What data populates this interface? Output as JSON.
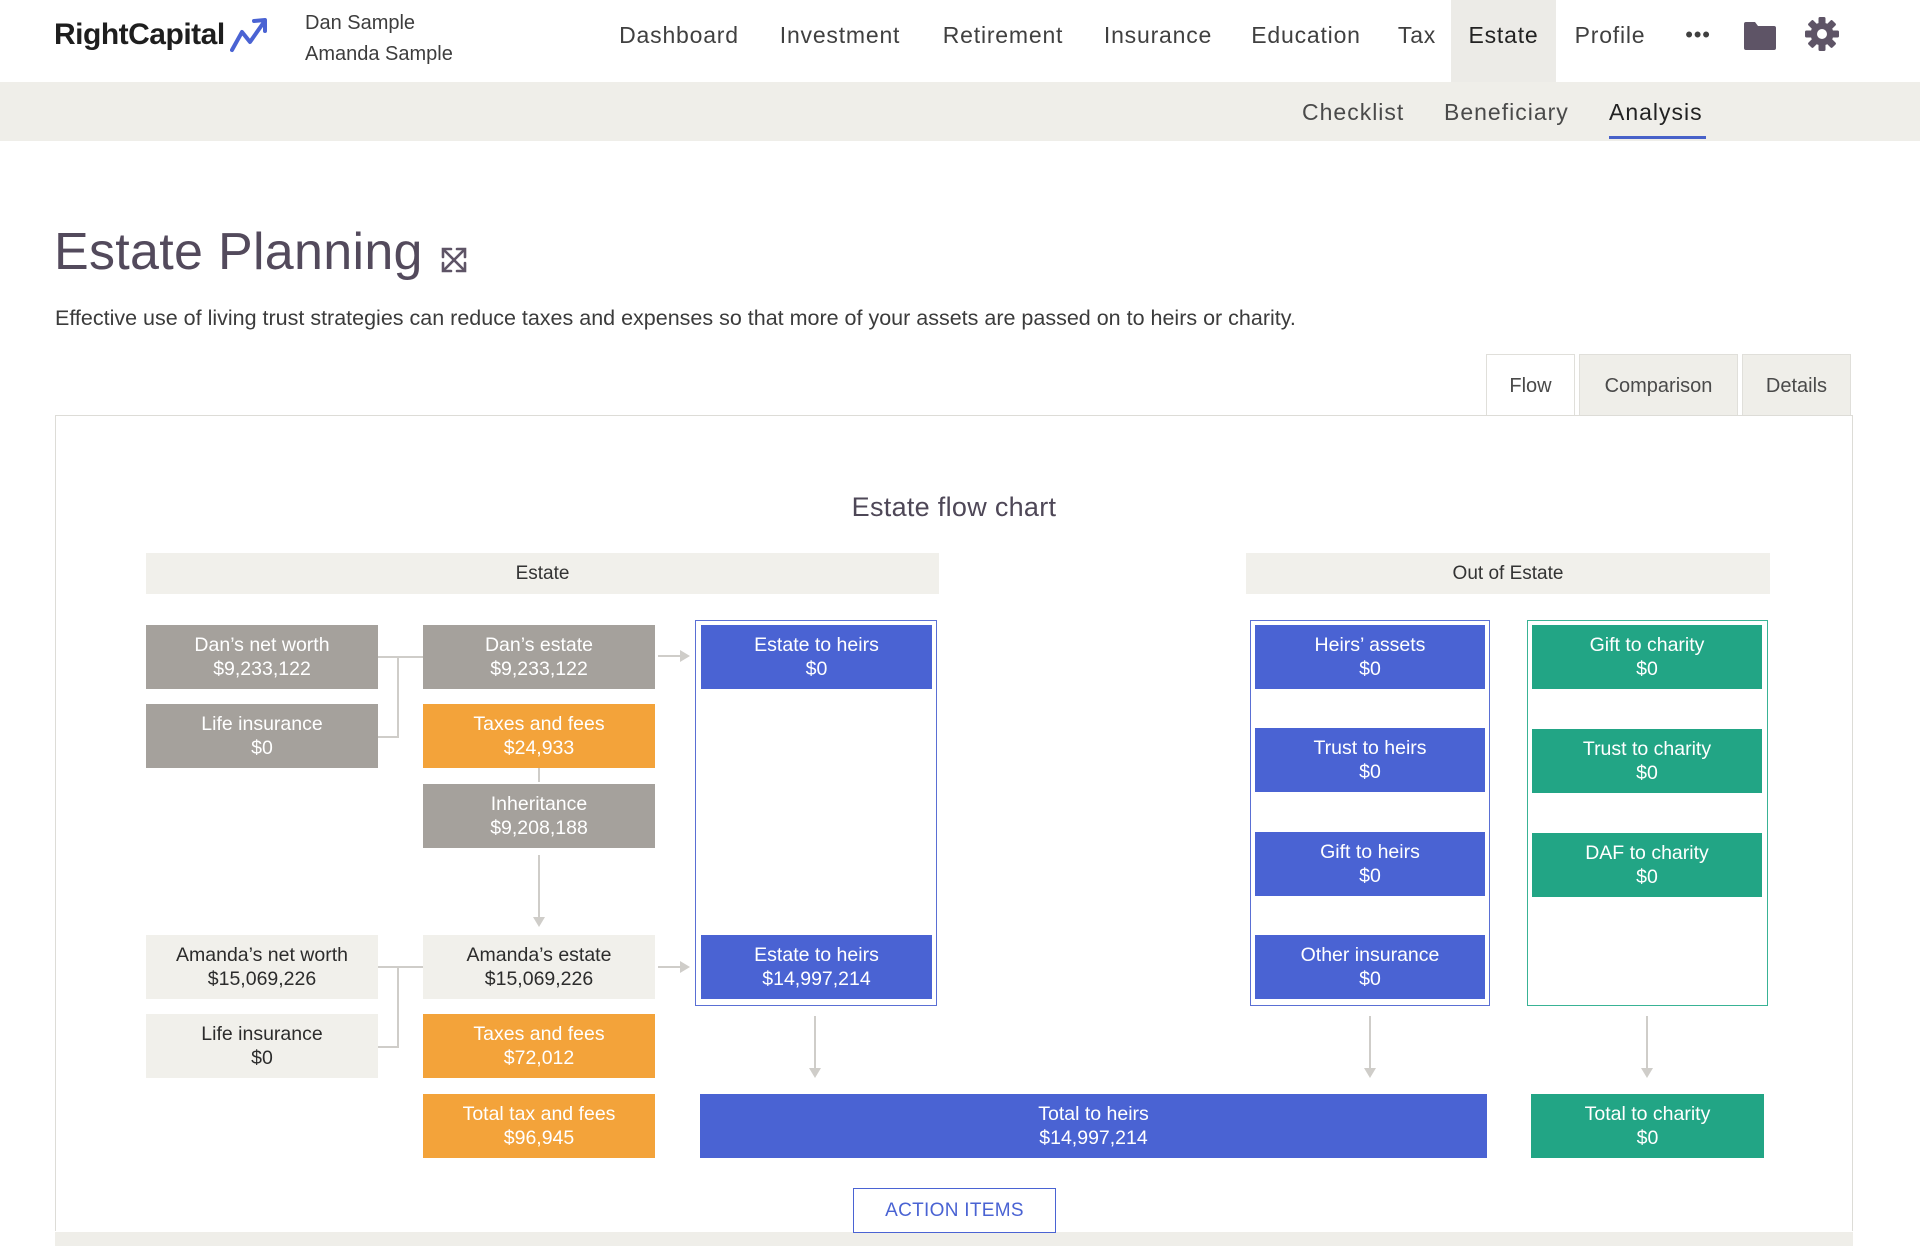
{
  "header": {
    "logo": "RightCapital",
    "clients": [
      "Dan Sample",
      "Amanda Sample"
    ],
    "nav": [
      "Dashboard",
      "Investment",
      "Retirement",
      "Insurance",
      "Education",
      "Tax",
      "Estate",
      "Profile"
    ],
    "more": "•••",
    "icons": [
      "folder-icon",
      "gear-icon"
    ]
  },
  "subnav": [
    "Checklist",
    "Beneficiary",
    "Analysis"
  ],
  "page": {
    "title": "Estate Planning",
    "description": "Effective use of living trust strategies can reduce taxes and expenses so that more of your assets are passed on to heirs or charity."
  },
  "tabs": [
    "Flow",
    "Comparison",
    "Details"
  ],
  "chart": {
    "title": "Estate flow chart",
    "estate_header": "Estate",
    "out_header": "Out of Estate",
    "dan_net_worth": {
      "label": "Dan’s net worth",
      "value": "$9,233,122"
    },
    "dan_life": {
      "label": "Life insurance",
      "value": "$0"
    },
    "dan_estate": {
      "label": "Dan’s estate",
      "value": "$9,233,122"
    },
    "dan_taxes": {
      "label": "Taxes and fees",
      "value": "$24,933"
    },
    "inheritance": {
      "label": "Inheritance",
      "value": "$9,208,188"
    },
    "dan_to_heirs": {
      "label": "Estate to heirs",
      "value": "$0"
    },
    "amanda_net_worth": {
      "label": "Amanda’s net worth",
      "value": "$15,069,226"
    },
    "amanda_life": {
      "label": "Life insurance",
      "value": "$0"
    },
    "amanda_estate": {
      "label": "Amanda’s estate",
      "value": "$15,069,226"
    },
    "amanda_taxes": {
      "label": "Taxes and fees",
      "value": "$72,012"
    },
    "amanda_to_heirs": {
      "label": "Estate to heirs",
      "value": "$14,997,214"
    },
    "total_tax": {
      "label": "Total tax and fees",
      "value": "$96,945"
    },
    "total_heirs": {
      "label": "Total to heirs",
      "value": "$14,997,214"
    },
    "heirs_assets": {
      "label": "Heirs’ assets",
      "value": "$0"
    },
    "trust_heirs": {
      "label": "Trust to heirs",
      "value": "$0"
    },
    "gift_heirs": {
      "label": "Gift to heirs",
      "value": "$0"
    },
    "other_insurance": {
      "label": "Other insurance",
      "value": "$0"
    },
    "gift_charity": {
      "label": "Gift to charity",
      "value": "$0"
    },
    "trust_charity": {
      "label": "Trust to charity",
      "value": "$0"
    },
    "daf_charity": {
      "label": "DAF to charity",
      "value": "$0"
    },
    "total_charity": {
      "label": "Total to charity",
      "value": "$0"
    }
  },
  "action_button": "ACTION ITEMS",
  "colors": {
    "accent_blue": "#4a63d3",
    "green": "#22a585",
    "orange": "#f3a33a",
    "gray": "#a5a19c"
  }
}
